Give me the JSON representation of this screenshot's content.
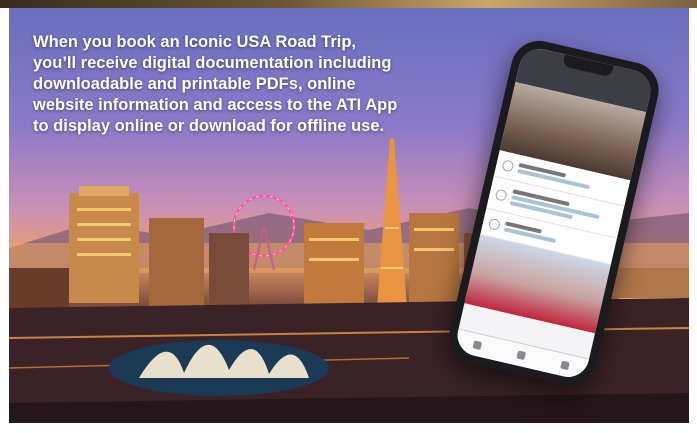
{
  "caption": "When you book an Iconic USA Road Trip, you’ll receive digital documentation including downloadable and printable PDFs, online website information and access to the ATI App to display online or download for offline use.",
  "colors": {
    "sky_top": "#6a6fc0",
    "sky_glow": "#e8a06c",
    "city_lights": "#ffd27a",
    "fountain": "#fff3d8"
  },
  "phone": {
    "status": "app-screenshot"
  }
}
